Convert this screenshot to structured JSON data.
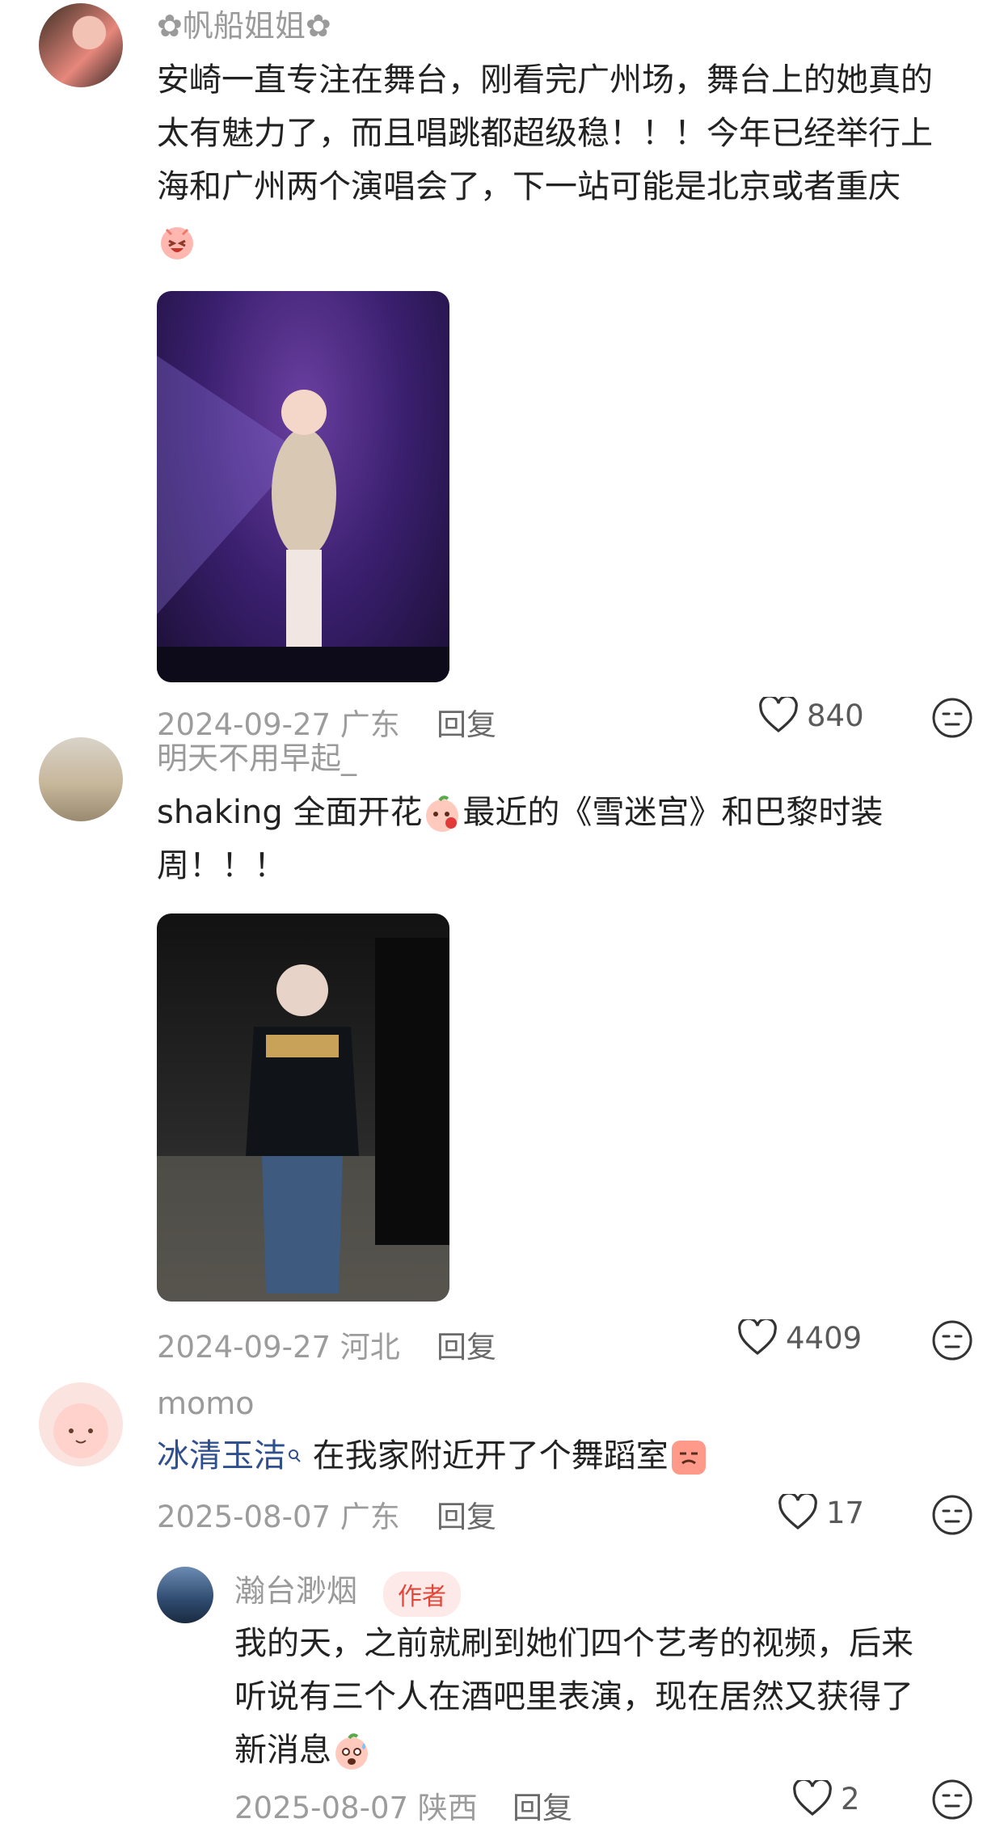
{
  "comments": [
    {
      "username": "✿帆船姐姐✿",
      "text_lines": [
        "安崎一直专注在舞台，刚看完广州场，舞台上的她真的",
        "太有魅力了，而且唱跳都超级稳！！！今年已经举行上",
        "海和广州两个演唱会了，下一站可能是北京或者重庆"
      ],
      "date": "2024-09-27",
      "location": "广东",
      "reply_label": "回复",
      "likes": "840"
    },
    {
      "username": "明天不用早起_",
      "text_part1": "shaking 全面开花",
      "text_part2": "最近的《雪迷宫》和巴黎时装",
      "text_line2": "周！！！",
      "date": "2024-09-27",
      "location": "河北",
      "reply_label": "回复",
      "likes": "4409"
    },
    {
      "username": "momo",
      "link_text": "冰清玉洁",
      "text_after_link": " 在我家附近开了个舞蹈室",
      "date": "2025-08-07",
      "location": "广东",
      "reply_label": "回复",
      "likes": "17"
    }
  ],
  "reply": {
    "username": "瀚台渺烟",
    "author_tag": "作者",
    "text_lines": [
      "我的天，之前就刷到她们四个艺考的视频，后来",
      "听说有三个人在酒吧里表演，现在居然又获得了",
      "新消息"
    ],
    "date": "2025-08-07",
    "location": "陕西",
    "reply_label": "回复",
    "likes": "2"
  },
  "colors": {
    "accent": "#e0473a",
    "link": "#2f4f8f",
    "meta": "#9c9c9c"
  }
}
